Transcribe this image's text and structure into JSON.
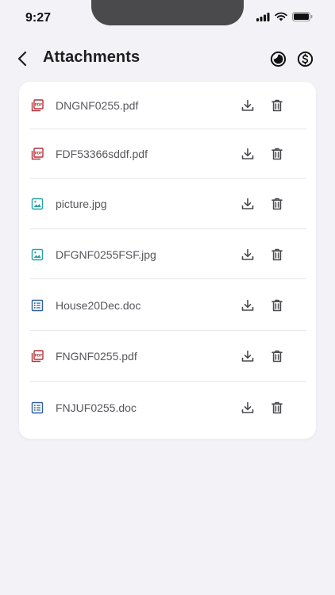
{
  "status_bar": {
    "time": "9:27"
  },
  "header": {
    "title": "Attachments"
  },
  "attachments": [
    {
      "name": "DNGNF0255.pdf",
      "type": "pdf"
    },
    {
      "name": "FDF53366sddf.pdf",
      "type": "pdf"
    },
    {
      "name": "picture.jpg",
      "type": "image"
    },
    {
      "name": "DFGNF0255FSF.jpg",
      "type": "image"
    },
    {
      "name": "House20Dec.doc",
      "type": "doc"
    },
    {
      "name": "FNGNF0255.pdf",
      "type": "pdf"
    },
    {
      "name": "FNJUF0255.doc",
      "type": "doc"
    }
  ],
  "icons": {
    "pdf": "pdf-file-icon",
    "image": "image-file-icon",
    "doc": "doc-file-icon",
    "download": "download-icon",
    "delete": "trash-icon"
  },
  "colors": {
    "pdf": "#b3303a",
    "image": "#26a3a8",
    "doc": "#2f5f9e",
    "action": "#4a4a4f",
    "background": "#f2f2f7"
  }
}
